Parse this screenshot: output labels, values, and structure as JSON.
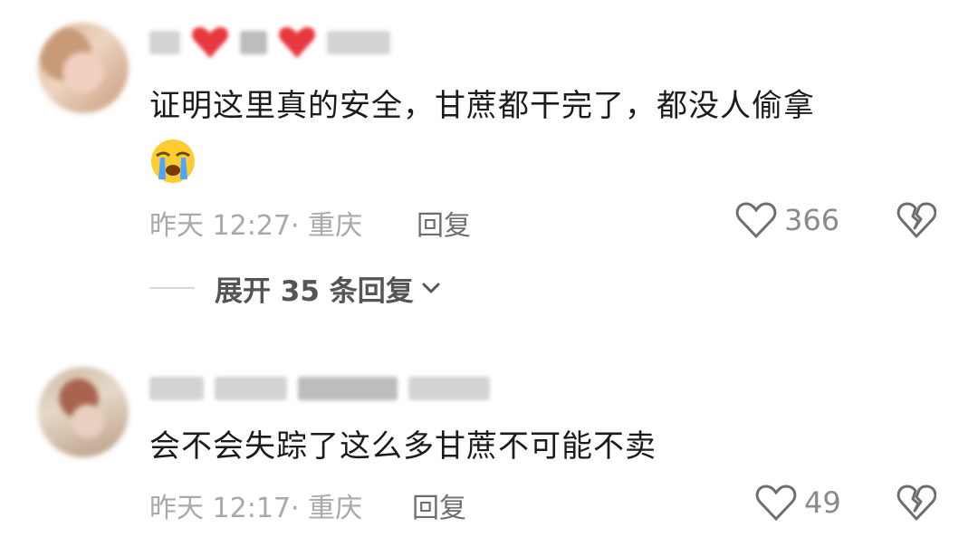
{
  "comments": [
    {
      "text_line1": "证明这里真的安全，甘蔗都干完了，都没人偷拿",
      "emoji": "loudly-crying-face",
      "time_location": "昨天 12:27· 重庆",
      "reply_label": "回复",
      "likes": "366",
      "expand_replies": "展开 35 条回复"
    },
    {
      "text_line1": "会不会失踪了这么多甘蔗不可能不卖",
      "time_location": "昨天 12:17· 重庆",
      "reply_label": "回复",
      "likes": "49"
    }
  ],
  "colors": {
    "text": "#1b1b1b",
    "meta": "#a9a9a9",
    "badge_red": "#e8383d",
    "icon_gray": "#6e6e6e"
  }
}
